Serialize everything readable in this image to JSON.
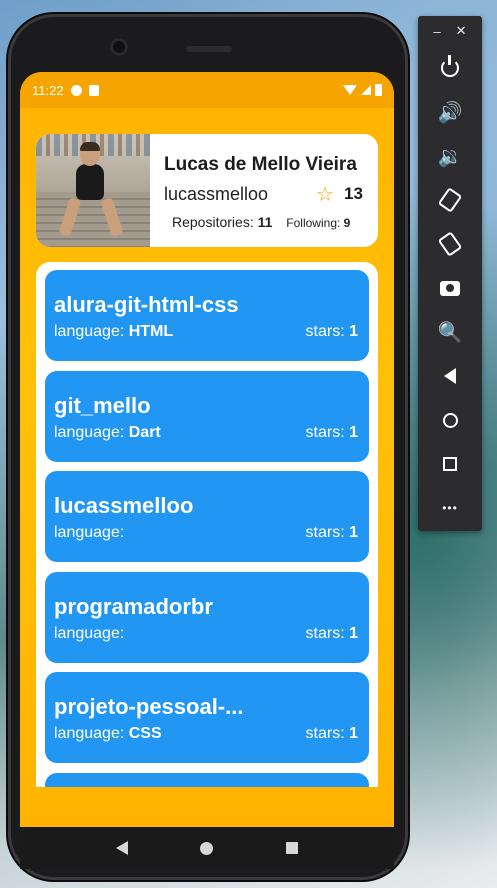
{
  "status_bar": {
    "time": "11:22"
  },
  "profile": {
    "name": "Lucas de Mello Vieira",
    "login": "lucassmelloo",
    "star_icon": "star-outline-icon",
    "stars": "13",
    "repositories_label": "Repositories:",
    "repositories": "11",
    "following_label": "Following:",
    "following": "9"
  },
  "repos": [
    {
      "name": "alura-git-html-css",
      "language_label": "language:",
      "language": "HTML",
      "stars_label": "stars:",
      "stars": "1"
    },
    {
      "name": "git_mello",
      "language_label": "language:",
      "language": "Dart",
      "stars_label": "stars:",
      "stars": "1"
    },
    {
      "name": "lucassmelloo",
      "language_label": "language:",
      "language": "",
      "stars_label": "stars:",
      "stars": "1"
    },
    {
      "name": "programadorbr",
      "language_label": "language:",
      "language": "",
      "stars_label": "stars:",
      "stars": "1"
    },
    {
      "name": "projeto-pessoal-...",
      "language_label": "language:",
      "language": "CSS",
      "stars_label": "stars:",
      "stars": "1"
    }
  ],
  "emulator_panel": {
    "minimize": "–",
    "close": "✕",
    "more": "•••"
  },
  "colors": {
    "accent": "#ffb300",
    "card": "#2196f3"
  }
}
